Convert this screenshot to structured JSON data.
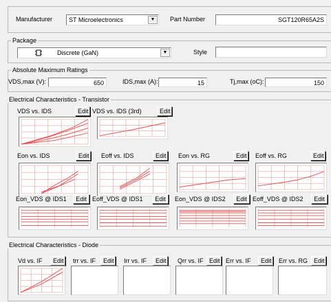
{
  "manufacturer": {
    "label": "Manufacturer",
    "value": "ST Microelectronics"
  },
  "part_number": {
    "label": "Part Number",
    "value": "SGT120R65A2S"
  },
  "package": {
    "legend": "Package",
    "type": "Discrete (GaN)",
    "icon": "transistor-package-icon",
    "style_label": "Style",
    "style_value": ""
  },
  "ratings": {
    "legend": "Absolute Maximum Ratings",
    "vds_label": "VDS,max (V):",
    "vds_value": "650",
    "ids_label": "IDS,max (A):",
    "ids_value": "15",
    "tj_label": "Tj,max (oC):",
    "tj_value": "150"
  },
  "transistor": {
    "legend": "Electrical Characteristics - Transistor",
    "edit_label": "Edit",
    "row1": [
      "VDS vs. IDS",
      "VDS vs. IDS (3rd)"
    ],
    "row2": [
      "Eon vs. IDS",
      "Eoff vs. IDS",
      "Eon vs. RG",
      "Eoff vs. RG"
    ],
    "row3": [
      "Eon_VDS @ IDS1",
      "Eoff_VDS @ IDS1",
      "Eon_VDS @ IDS2",
      "Eoff_VDS @ IDS2"
    ]
  },
  "diode": {
    "legend": "Electrical Characteristics - Diode",
    "edit_label": "Edit",
    "plots": [
      "Vd vs. IF",
      "trr vs. IF",
      "Irr vs. IF",
      "Qrr vs. IF",
      "Err vs. IF",
      "Err vs. RG"
    ]
  },
  "colors": {
    "grid": "#e9b3b3",
    "curve": "#e05050",
    "background": "#f0f0f0"
  }
}
